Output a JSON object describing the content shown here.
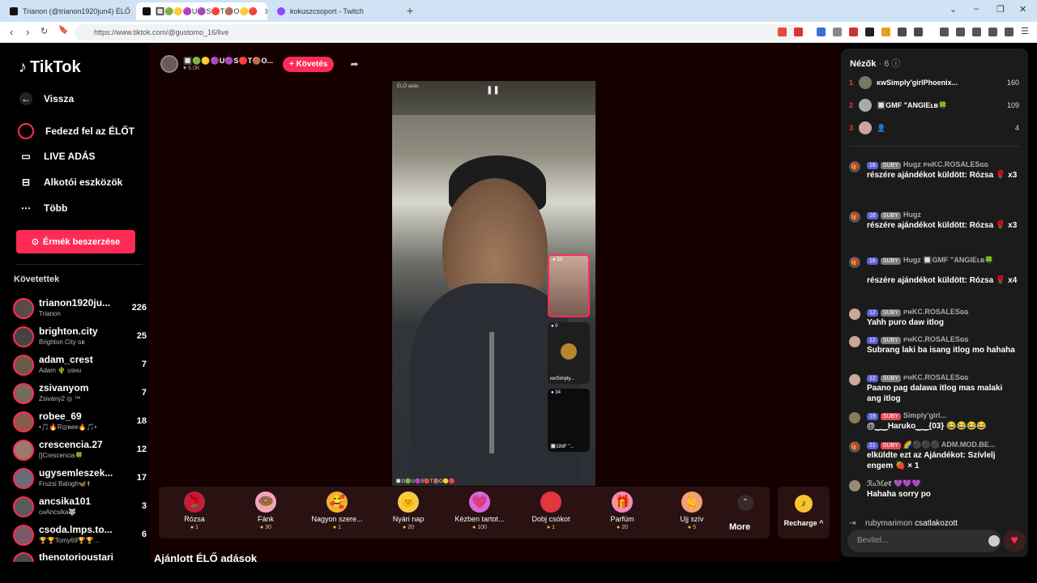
{
  "browser": {
    "tabs": [
      {
        "title": "Trianon (@trianon1920jun4) ÉLŐ adás"
      },
      {
        "title": "🔲🟢🟡🟣U🟣S🔴T🟤O🟡🔴"
      },
      {
        "title": "kokuszcsoport - Twitch"
      }
    ],
    "url": "https://www.tiktok.com/@gustomo_16/live"
  },
  "sidebar": {
    "logo": "TikTok",
    "back": "Vissza",
    "nav": [
      "Fedezd fel az ÉLŐT",
      "LIVE ADÁS",
      "Alkotói eszközök",
      "Több"
    ],
    "coins_button": "Érmék beszerzése",
    "following_header": "Követettek",
    "following": [
      {
        "name": "trianon1920ju...",
        "sub": "Trianon",
        "count": "226"
      },
      {
        "name": "brighton.city",
        "sub": "Brighton City ɢʙ",
        "count": "25"
      },
      {
        "name": "adam_crest",
        "sub": "Adam 🌵 ᴜsʜᴜ",
        "count": "7"
      },
      {
        "name": "zsivanyom",
        "sub": "Zsivány2 ◎ ™",
        "count": "7"
      },
      {
        "name": "robee_69",
        "sub": "•🎵🔥R◎ʙee🔥🎵•",
        "count": "18"
      },
      {
        "name": "crescencia.27",
        "sub": "[]Crescencia🍀",
        "count": "12"
      },
      {
        "name": "ugysemleszek...",
        "sub": "Fruzsi Balogh🦋🕇",
        "count": "17"
      },
      {
        "name": "ancsika101",
        "sub": "ᴄʜAncsika🐺",
        "count": "3"
      },
      {
        "name": "csoda.lmps.to...",
        "sub": "🏆🏆Tomy69🏆🏆...",
        "count": "6"
      },
      {
        "name": "thenotorioustari",
        "sub": "",
        "count": ""
      }
    ]
  },
  "stream": {
    "host_name": "🔲🟢🟡🟣U🟣S🔴T🟤O...",
    "likes": "6.0K",
    "follow_button": "+ Követés",
    "video_label": "ÉLŐ adás",
    "guests": [
      {
        "count": "33",
        "name": ""
      },
      {
        "count": "0",
        "name": "ᴋwSimply..."
      },
      {
        "count": "34",
        "name": "🔲GMF \"..."
      }
    ],
    "footer_name": "🔲G🟢U🟣S🔴T🟤O🟡🔴"
  },
  "gifts": [
    {
      "name": "Rózsa",
      "price": "1",
      "icon": "🌹",
      "color": "#c0203a"
    },
    {
      "name": "Fánk",
      "price": "30",
      "icon": "🍩",
      "color": "#f3a3c0"
    },
    {
      "name": "Nagyon szere...",
      "price": "1",
      "icon": "🥰",
      "color": "#f2b233"
    },
    {
      "name": "Nyári nap",
      "price": "20",
      "icon": "🌞",
      "color": "#f6c94a"
    },
    {
      "name": "Kézben tartot...",
      "price": "100",
      "icon": "💗",
      "color": "#d46bd6"
    },
    {
      "name": "Dobj csókot",
      "price": "1",
      "icon": "💋",
      "color": "#e0344a"
    },
    {
      "name": "Parfüm",
      "price": "20",
      "icon": "🎁",
      "color": "#f08ac0"
    },
    {
      "name": "Ujj szív",
      "price": "5",
      "icon": "🫰",
      "color": "#f2a07a"
    }
  ],
  "more_label": "More",
  "recharge_label": "Recharge ^",
  "recommended_header": "Ajánlott ÉLŐ adások",
  "chat": {
    "viewers_label": "Nézők",
    "viewers_count": "· 6",
    "ranking": [
      {
        "rank": "1",
        "name": "ᴋwSimply'girlPhoenix...",
        "count": "160"
      },
      {
        "rank": "2",
        "name": "🔲GMF \"ANGIEʟʙ🍀",
        "count": "109"
      },
      {
        "rank": "3",
        "name": "👤",
        "count": "4"
      }
    ],
    "messages": [
      {
        "icon": "🎁",
        "level": "16",
        "fan": "SUBY",
        "user": "Hugz ᴘʜKC.ROSALESɢɢ",
        "text": "részére ajándékot küldött: Rózsa 🌹 x3"
      },
      {
        "icon": "🎁",
        "level": "16",
        "fan": "SUBY",
        "user": "Hugz",
        "text": "részére ajándékot küldött: Rózsa 🌹 x3"
      },
      {
        "icon": "🎁",
        "level": "16",
        "fan": "SUBY",
        "user": "Hugz 🔲GMF \"ANGIEʟʙ🍀",
        "text": "részére ajándékot küldött: Rózsa 🌹 x4"
      },
      {
        "icon": "",
        "level": "12",
        "fan": "SUBY",
        "user": "ᴘʜKC.ROSALESɢɢ",
        "text": "Yahh puro daw itlog"
      },
      {
        "icon": "",
        "level": "12",
        "fan": "SUBY",
        "user": "ᴘʜKC.ROSALESɢɢ",
        "text": "Subrang laki ba isang itlog mo hahaha"
      },
      {
        "icon": "",
        "level": "12",
        "fan": "SUBY",
        "user": "ᴘʜKC.ROSALESɢɢ",
        "text": "Paano pag dalawa itlog mas malaki ang itlog"
      },
      {
        "icon": "",
        "level": "19",
        "fan": "SUBY",
        "user": "Simply'girl...",
        "text": "@‿‿Haruko‿‿{03} 😂😂😂😂"
      },
      {
        "icon": "🎁",
        "level": "21",
        "fan": "SUBY",
        "user": "🌈⚫⚫⚫ ADM.MOD.BE...",
        "text": "elküldte ezt az Ajándékot: Szívlelj engem 🍓 × 1"
      },
      {
        "icon": "",
        "level": "",
        "fan": "",
        "user": "ℛℴℳℯℓ 💜💜💜",
        "text": "Hahaha sorry po"
      }
    ],
    "joined_user": "rubymarimon",
    "joined_text": "csatlakozott",
    "input_placeholder": "Bevitel..."
  },
  "colors": {
    "accent": "#fe2c55",
    "stage_bg": "#150000",
    "chat_bg": "#1b1b1b"
  }
}
